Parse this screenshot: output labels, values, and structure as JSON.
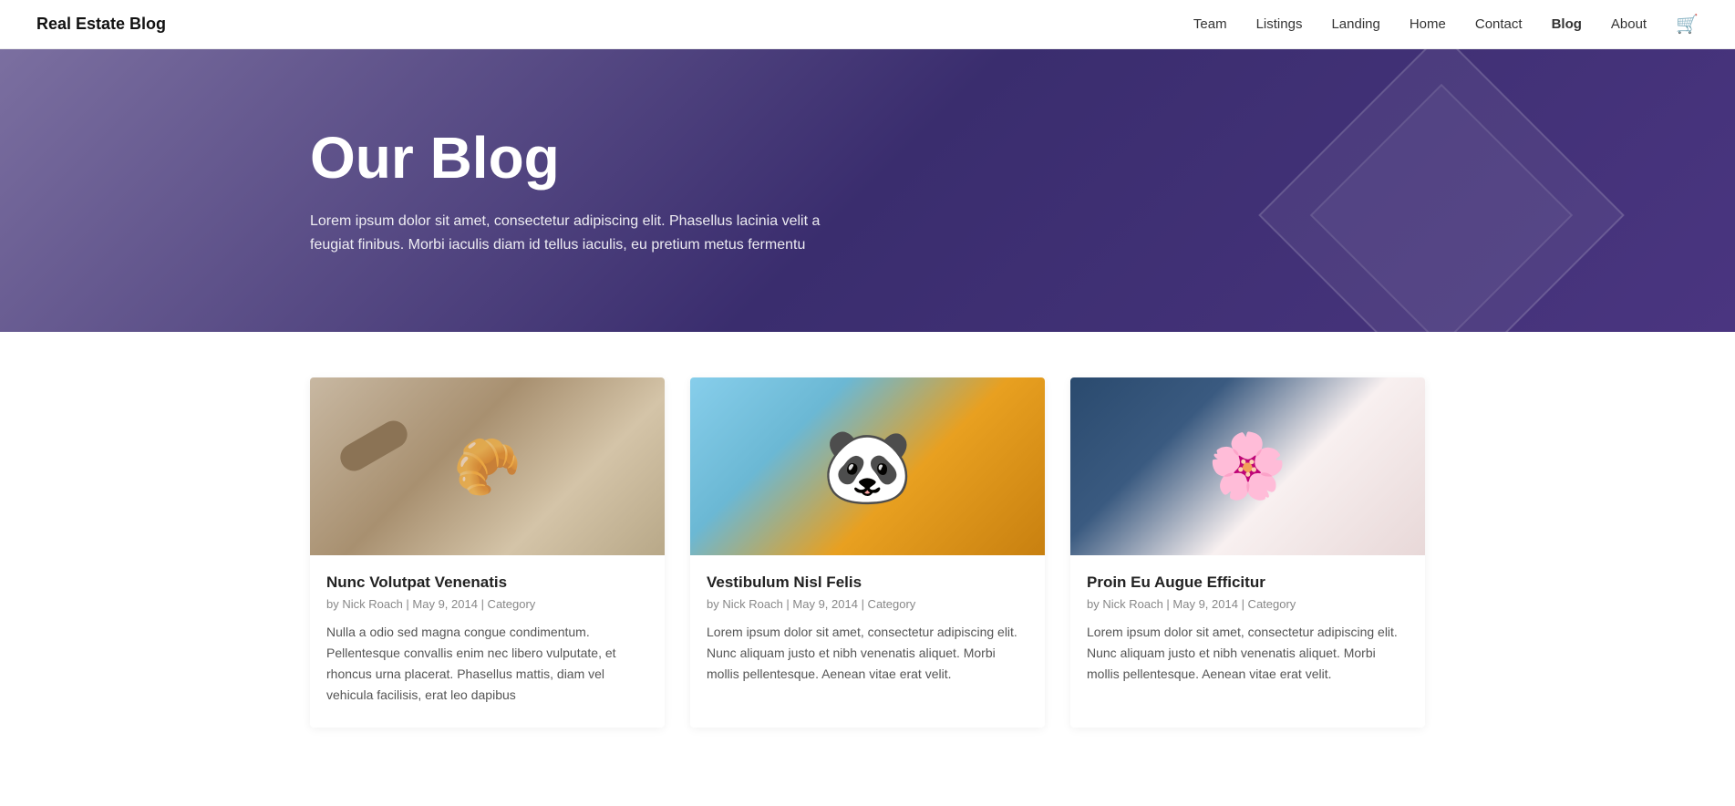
{
  "nav": {
    "logo": "Real Estate Blog",
    "links": [
      {
        "label": "Team",
        "href": "#",
        "active": false
      },
      {
        "label": "Listings",
        "href": "#",
        "active": false
      },
      {
        "label": "Landing",
        "href": "#",
        "active": false
      },
      {
        "label": "Home",
        "href": "#",
        "active": false
      },
      {
        "label": "Contact",
        "href": "#",
        "active": false
      },
      {
        "label": "Blog",
        "href": "#",
        "active": true
      },
      {
        "label": "About",
        "href": "#",
        "active": false
      }
    ]
  },
  "hero": {
    "title": "Our Blog",
    "description": "Lorem ipsum dolor sit amet, consectetur adipiscing elit. Phasellus lacinia velit a feugiat finibus. Morbi iaculis diam id tellus iaculis, eu pretium metus fermentu"
  },
  "blog": {
    "cards": [
      {
        "image_class": "img-baking",
        "title": "Nunc Volutpat Venenatis",
        "author": "Nick Roach",
        "date": "May 9, 2014",
        "category": "Category",
        "text": "Nulla a odio sed magna congue condimentum. Pellentesque convallis enim nec libero vulputate, et rhoncus urna placerat. Phasellus mattis, diam vel vehicula facilisis, erat leo dapibus"
      },
      {
        "image_class": "img-panda",
        "title": "Vestibulum Nisl Felis",
        "author": "Nick Roach",
        "date": "May 9, 2014",
        "category": "Category",
        "text": "Lorem ipsum dolor sit amet, consectetur adipiscing elit. Nunc aliquam justo et nibh venenatis aliquet. Morbi mollis pellentesque. Aenean vitae erat velit."
      },
      {
        "image_class": "img-flowers",
        "title": "Proin Eu Augue Efficitur",
        "author": "Nick Roach",
        "date": "May 9, 2014",
        "category": "Category",
        "text": "Lorem ipsum dolor sit amet, consectetur adipiscing elit. Nunc aliquam justo et nibh venenatis aliquet. Morbi mollis pellentesque. Aenean vitae erat velit."
      }
    ]
  }
}
